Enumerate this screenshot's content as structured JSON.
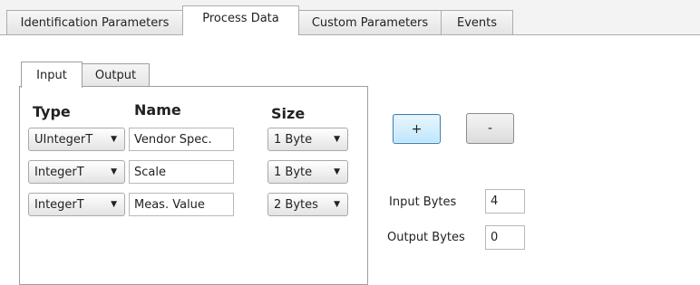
{
  "outer_tabs": [
    {
      "label": "Identification Parameters",
      "active": false
    },
    {
      "label": "Process Data",
      "active": true
    },
    {
      "label": "Custom Parameters",
      "active": false
    },
    {
      "label": "Events",
      "active": false
    }
  ],
  "inner_tabs": [
    {
      "label": "Input",
      "active": true
    },
    {
      "label": "Output",
      "active": false
    }
  ],
  "table": {
    "headers": {
      "type": "Type",
      "name": "Name",
      "size": "Size"
    },
    "rows": [
      {
        "type": "UIntegerT",
        "name": "Vendor Spec.",
        "size": "1 Byte"
      },
      {
        "type": "IntegerT",
        "name": "Scale",
        "size": "1 Byte"
      },
      {
        "type": "IntegerT",
        "name": "Meas. Value",
        "size": "2 Bytes"
      }
    ]
  },
  "buttons": {
    "add_label": "+",
    "remove_label": "-"
  },
  "fields": {
    "input_bytes_label": "Input Bytes",
    "input_bytes_value": "4",
    "output_bytes_label": "Output Bytes",
    "output_bytes_value": "0"
  },
  "icons": {
    "dropdown": "chevron-down-icon"
  },
  "colors": {
    "accent_button_border": "#3c7fb1",
    "accent_button_fill": "#bee6fd"
  }
}
